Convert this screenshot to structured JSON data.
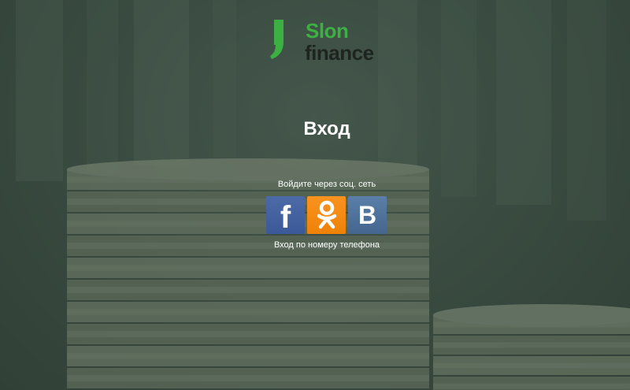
{
  "brand": {
    "line1": "Slon",
    "line2": "finance",
    "accent_color": "#3cb043",
    "dark_color": "#1e2420",
    "mark_icon": "comma-logo-mark"
  },
  "page": {
    "title": "Вход"
  },
  "social": {
    "caption": "Войдите через соц. сеть",
    "buttons": [
      {
        "name": "facebook",
        "glyph": "f",
        "color": "#3b5998"
      },
      {
        "name": "odnoklassniki",
        "glyph": "ok-icon",
        "color": "#ee8208"
      },
      {
        "name": "vkontakte",
        "glyph": "B",
        "color": "#45668e"
      }
    ]
  },
  "phone_login": {
    "label": "Вход по номеру телефона"
  }
}
